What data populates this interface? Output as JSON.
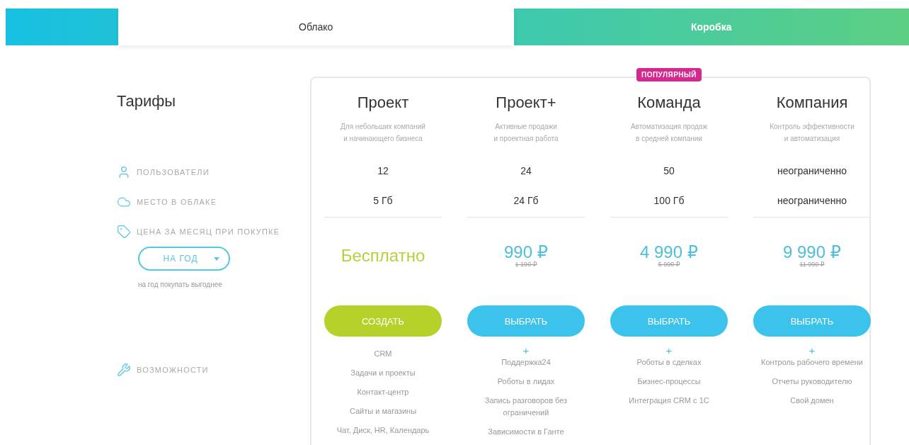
{
  "tabs": [
    {
      "label": "Облако",
      "selected": true
    },
    {
      "label": "Коробка",
      "selected": false
    }
  ],
  "sidebar": {
    "title": "Тарифы",
    "rows": [
      {
        "kind": "user",
        "label": "ПОЛЬЗОВАТЕЛИ"
      },
      {
        "kind": "cloud",
        "label": "МЕСТО В ОБЛАКЕ"
      },
      {
        "kind": "tag",
        "label": "ЦЕНА ЗА МЕСЯЦ ПРИ ПОКУПКЕ"
      }
    ],
    "period": {
      "value": "НА ГОД",
      "hint": "на год покупать выгоднее"
    },
    "features_label": "ВОЗМОЖНОСТИ"
  },
  "plans": [
    {
      "name": "Проект",
      "description": [
        "Для небольших компаний",
        "и начинающего бизнеса"
      ],
      "users": "12",
      "storage": "5 Гб",
      "kind": "free",
      "price": "Бесплатно",
      "button": "СОЗДАТЬ",
      "features": [
        "CRM",
        "Задачи и проекты",
        "Контакт-центр",
        "Сайты и магазины",
        "Чат, Диск, HR, Календарь"
      ]
    },
    {
      "name": "Проект+",
      "description": [
        "Активные продажи",
        "и проектная работа"
      ],
      "users": "24",
      "storage": "24 Гб",
      "kind": "paid",
      "price": "990 ₽",
      "old_price": "1 190 ₽",
      "button": "ВЫБРАТЬ",
      "plus": "+",
      "features": [
        "Поддержка24",
        "Роботы в лидах",
        "Запись разговоров без ограничений",
        "Зависимости в Ганте"
      ]
    },
    {
      "name": "Команда",
      "badge": "ПОПУЛЯРНЫЙ",
      "description": [
        "Автоматизация продаж",
        "в средней компании"
      ],
      "users": "50",
      "storage": "100 Гб",
      "kind": "paid",
      "price": "4 990 ₽",
      "old_price": "5 990 ₽",
      "button": "ВЫБРАТЬ",
      "plus": "+",
      "features": [
        "Роботы в сделках",
        "Бизнес-процессы",
        "Интеграция CRM с 1С"
      ]
    },
    {
      "name": "Компания",
      "description": [
        "Контроль эффективности",
        "и автоматизация"
      ],
      "users": "неограниченно",
      "storage": "неограниченно",
      "kind": "paid",
      "price": "9 990 ₽",
      "old_price": "11 990 ₽",
      "button": "ВЫБРАТЬ",
      "plus": "+",
      "features": [
        "Контроль рабочего времени",
        "Отчеты руководителю",
        "Свой домен"
      ]
    }
  ]
}
